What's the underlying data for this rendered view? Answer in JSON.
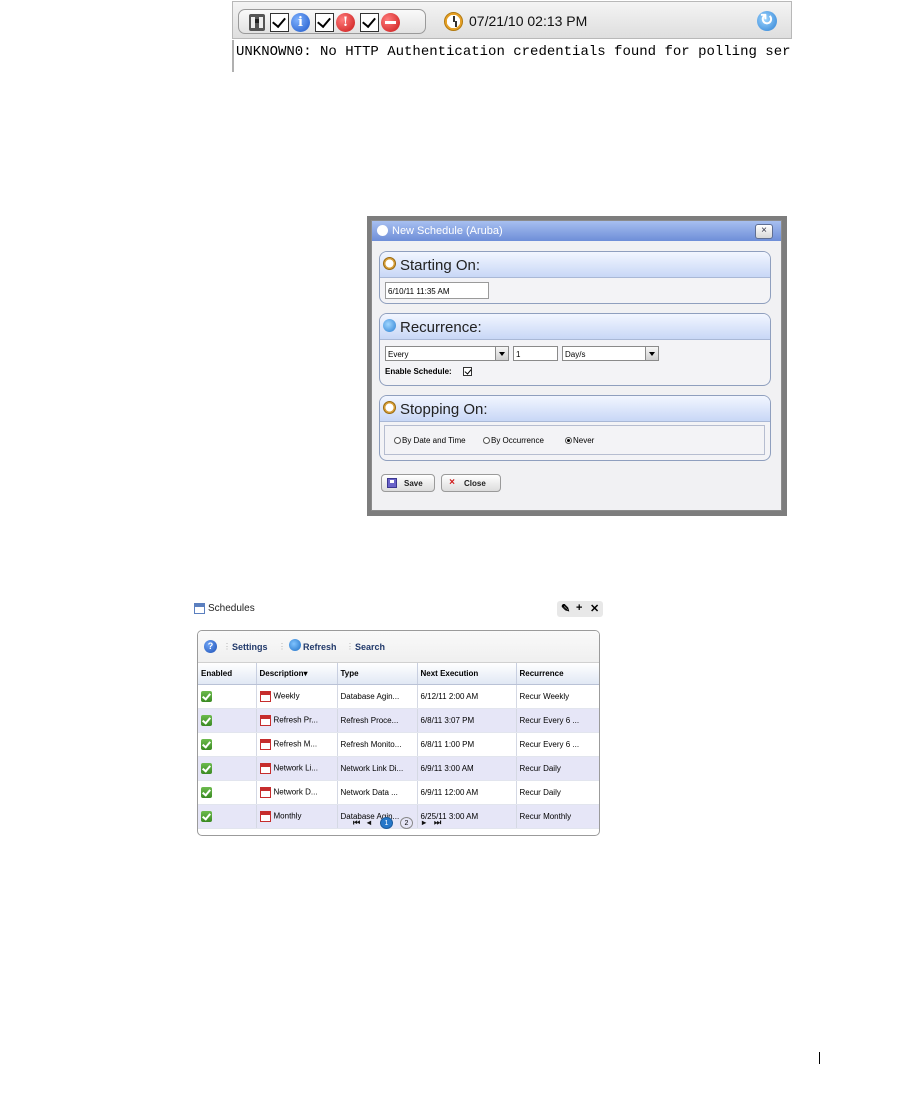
{
  "alarm_toolbar": {
    "datetime": "07/21/10 02:13 PM",
    "log_message": "UNKNOWN0: No HTTP Authentication credentials found for polling ser"
  },
  "new_schedule_dialog": {
    "title": "New Schedule (Aruba)",
    "close_symbol": "×",
    "starting_on": {
      "heading": "Starting On:",
      "value": "6/10/11 11:35 AM"
    },
    "recurrence": {
      "heading": "Recurrence:",
      "mode": "Every",
      "interval": "1",
      "unit": "Day/s",
      "enable_label": "Enable Schedule:",
      "enabled": true
    },
    "stopping_on": {
      "heading": "Stopping On:",
      "options": [
        "By Date and Time",
        "By Occurrence",
        "Never"
      ],
      "selected": "Never"
    },
    "buttons": {
      "save": "Save",
      "close": "Close"
    }
  },
  "schedules": {
    "title": "Schedules",
    "tools": {
      "wrench": "✎",
      "add": "+",
      "close": "✕"
    },
    "toolbar": {
      "help": "?",
      "settings": "Settings",
      "refresh": "Refresh",
      "search": "Search"
    },
    "columns": [
      "Enabled",
      "Description",
      "Type",
      "Next Execution",
      "Recurrence"
    ],
    "sort_marker": "▾",
    "rows": [
      {
        "description": "Weekly",
        "type": "Database Agin...",
        "next": "6/12/11 2:00 AM",
        "recurrence": "Recur Weekly"
      },
      {
        "description": "Refresh Pr...",
        "type": "Refresh Proce...",
        "next": "6/8/11 3:07 PM",
        "recurrence": "Recur Every 6 ..."
      },
      {
        "description": "Refresh M...",
        "type": "Refresh Monito...",
        "next": "6/8/11 1:00 PM",
        "recurrence": "Recur Every 6 ..."
      },
      {
        "description": "Network Li...",
        "type": "Network Link Di...",
        "next": "6/9/11 3:00 AM",
        "recurrence": "Recur Daily"
      },
      {
        "description": "Network D...",
        "type": "Network Data ...",
        "next": "6/9/11 12:00 AM",
        "recurrence": "Recur Daily"
      },
      {
        "description": "Monthly",
        "type": "Database Agin...",
        "next": "6/25/11 3:00 AM",
        "recurrence": "Recur Monthly"
      }
    ],
    "pager": {
      "pages": [
        "1",
        "2"
      ],
      "current": "1"
    }
  },
  "icons": {
    "toolbar": [
      "binoculars-icon",
      "info-icon",
      "warning-icon",
      "stop-icon",
      "clock-icon",
      "refresh-icon"
    ],
    "grid": [
      "enabled-check-icon",
      "calendar-icon"
    ]
  },
  "colors": {
    "dialog_title": "#6e8ed8",
    "panel_header": "#c8d7f6",
    "row_stripe": "#e6e6f7",
    "enabled_green": "#3a8a22",
    "current_page": "#2677c9"
  }
}
